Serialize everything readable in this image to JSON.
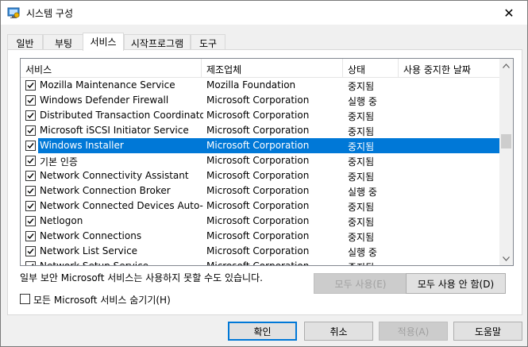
{
  "window": {
    "title": "시스템 구성",
    "close_glyph": "✕"
  },
  "tabs": [
    {
      "label": "일반",
      "active": false
    },
    {
      "label": "부팅",
      "active": false
    },
    {
      "label": "서비스",
      "active": true
    },
    {
      "label": "시작프로그램",
      "active": false
    },
    {
      "label": "도구",
      "active": false
    }
  ],
  "services": {
    "columns": [
      "서비스",
      "제조업체",
      "상태",
      "사용 중지한 날짜"
    ],
    "rows": [
      {
        "checked": true,
        "name": "Mozilla Maintenance Service",
        "manufacturer": "Mozilla Foundation",
        "status": "중지됨",
        "date": "",
        "selected": false
      },
      {
        "checked": true,
        "name": "Windows Defender Firewall",
        "manufacturer": "Microsoft Corporation",
        "status": "실행 중",
        "date": "",
        "selected": false
      },
      {
        "checked": true,
        "name": "Distributed Transaction Coordinator",
        "manufacturer": "Microsoft Corporation",
        "status": "중지됨",
        "date": "",
        "selected": false
      },
      {
        "checked": true,
        "name": "Microsoft iSCSI Initiator Service",
        "manufacturer": "Microsoft Corporation",
        "status": "중지됨",
        "date": "",
        "selected": false
      },
      {
        "checked": true,
        "name": "Windows Installer",
        "manufacturer": "Microsoft Corporation",
        "status": "중지됨",
        "date": "",
        "selected": true
      },
      {
        "checked": true,
        "name": "기본 인증",
        "manufacturer": "Microsoft Corporation",
        "status": "중지됨",
        "date": "",
        "selected": false
      },
      {
        "checked": true,
        "name": "Network Connectivity Assistant",
        "manufacturer": "Microsoft Corporation",
        "status": "중지됨",
        "date": "",
        "selected": false
      },
      {
        "checked": true,
        "name": "Network Connection Broker",
        "manufacturer": "Microsoft Corporation",
        "status": "실행 중",
        "date": "",
        "selected": false
      },
      {
        "checked": true,
        "name": "Network Connected Devices Auto-...",
        "manufacturer": "Microsoft Corporation",
        "status": "중지됨",
        "date": "",
        "selected": false
      },
      {
        "checked": true,
        "name": "Netlogon",
        "manufacturer": "Microsoft Corporation",
        "status": "중지됨",
        "date": "",
        "selected": false
      },
      {
        "checked": true,
        "name": "Network Connections",
        "manufacturer": "Microsoft Corporation",
        "status": "중지됨",
        "date": "",
        "selected": false
      },
      {
        "checked": true,
        "name": "Network List Service",
        "manufacturer": "Microsoft Corporation",
        "status": "실행 중",
        "date": "",
        "selected": false
      },
      {
        "checked": true,
        "name": "Network Setup Service",
        "manufacturer": "Microsoft Corporation",
        "status": "중지됨",
        "date": "",
        "selected": false
      }
    ]
  },
  "note_text": "일부 보안 Microsoft 서비스는 사용하지 못할 수도 있습니다.",
  "enable_all_label": "모두 사용(E)",
  "disable_all_label": "모두 사용 안 함(D)",
  "hide_ms_label": "모든 Microsoft 서비스 숨기기(H)",
  "hide_ms_checked": false,
  "footer": {
    "ok_label": "확인",
    "cancel_label": "취소",
    "apply_label": "적용(A)",
    "help_label": "도움말"
  },
  "colors": {
    "selection": "#0078d7",
    "default_button_border": "#0078d7"
  }
}
